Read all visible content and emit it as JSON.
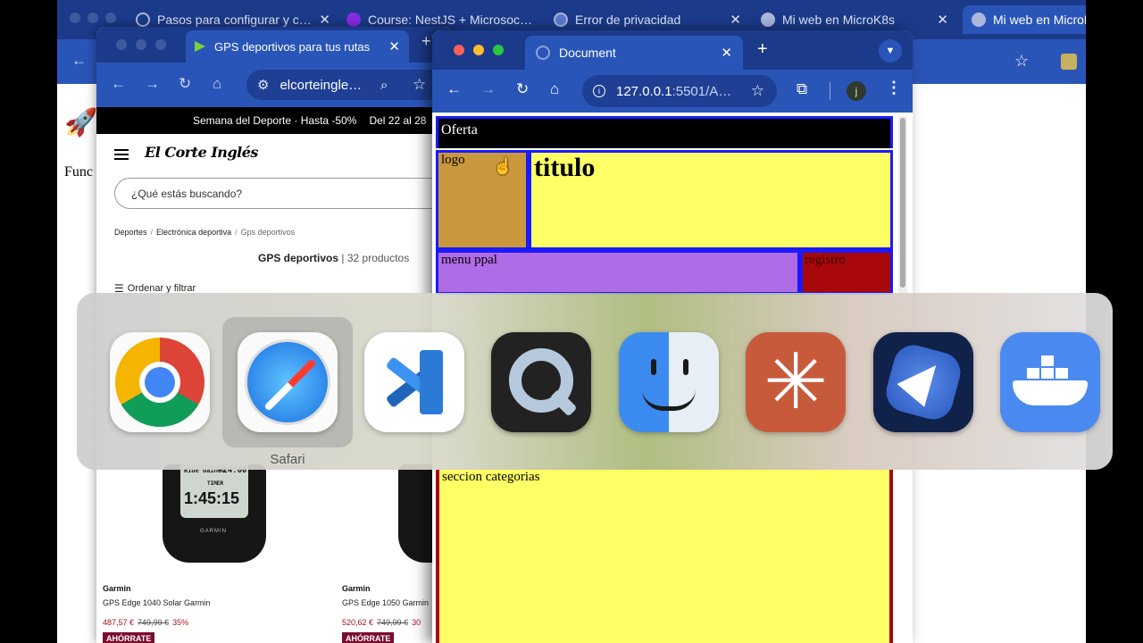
{
  "back_window": {
    "tabs": [
      {
        "title": "Pasos para configurar y c…",
        "icon": "loading-ring-icon"
      },
      {
        "title": "Course: NestJS + Microsoc…",
        "icon": "course-icon"
      },
      {
        "title": "Error de privacidad",
        "icon": "globe-icon"
      },
      {
        "title": "Mi web en MicroK8s",
        "icon": "github-icon"
      },
      {
        "title": "Mi web en MicroK",
        "icon": "github-icon"
      }
    ],
    "page_text": "Func"
  },
  "middle_window": {
    "tab_title": "GPS deportivos para tus rutas",
    "url": "elcorteingle…",
    "promo": "Semana del Deporte · Hasta -50%",
    "promo_date": "Del 22 al 28",
    "logo": "El Corte Inglés",
    "search_placeholder": "¿Qué estás buscando?",
    "breadcrumb": [
      "Deportes",
      "Electrónica deportiva",
      "Gps deportivos"
    ],
    "results_title": "GPS deportivos",
    "results_count": "32 productos",
    "sort_filter": "Ordenar y filtrar",
    "products": [
      {
        "brand": "Garmin",
        "name": "GPS Edge 1040 Solar Garmin",
        "price": "487,57 €",
        "old_price": "749,99 €",
        "discount": "35%",
        "badge": "AHÓRRATE",
        "screen_top": "Ride Gained",
        "screen_val": "+24:00",
        "screen_label": "TIMER",
        "screen_time": "1:45:15",
        "mark": "GARMIN"
      },
      {
        "brand": "Garmin",
        "name": "GPS Edge 1050 Garmin",
        "price": "520,62 €",
        "old_price": "749,99 €",
        "discount": "30",
        "badge": "AHÓRRATE"
      }
    ]
  },
  "front_window": {
    "tab_title": "Document",
    "url_host": "127.0.0.1",
    "url_port": ":5501/A…",
    "profile_initial": "j",
    "blocks": {
      "oferta": "Oferta",
      "logo": "logo",
      "titulo": "titulo",
      "menu": "menu ppal",
      "registro": "registro",
      "categorias": "seccion categorias"
    }
  },
  "app_switcher": {
    "apps": [
      "Chrome",
      "Safari",
      "Visual Studio Code",
      "QuickTime Player",
      "Finder",
      "Claude",
      "TestFlight",
      "Docker"
    ],
    "selected_label": "Safari"
  },
  "colors": {
    "chrome_tab_dark": "#1b3a8a",
    "chrome_toolbar": "#2a55b8",
    "oferta_bg": "#000000",
    "logo_bg": "#c9983c",
    "titulo_bg": "#ffff66",
    "menu_bg": "#b06be6",
    "registro_bg": "#a8080a",
    "block_border": "#1a1aff"
  }
}
